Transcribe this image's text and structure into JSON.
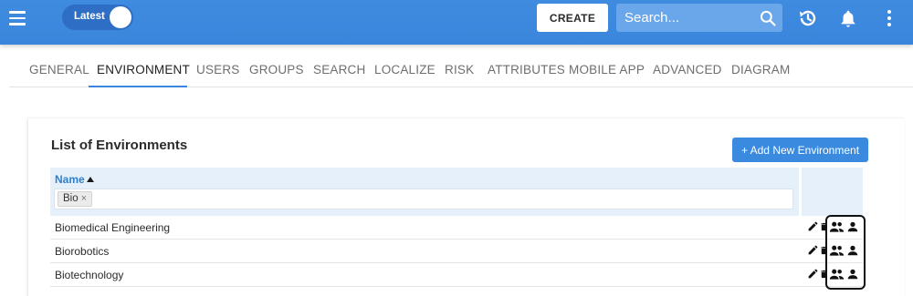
{
  "topbar": {
    "toggle_label": "Latest",
    "create_label": "CREATE",
    "search_placeholder": "Search...",
    "icons": [
      "menu-icon",
      "search-icon",
      "history-icon",
      "bell-icon",
      "more-vert-icon"
    ]
  },
  "tabs": [
    {
      "label": "GENERAL"
    },
    {
      "label": "ENVIRONMENT",
      "active": true
    },
    {
      "label": "USERS"
    },
    {
      "label": "GROUPS"
    },
    {
      "label": "SEARCH"
    },
    {
      "label": "LOCALIZE"
    },
    {
      "label": "RISK"
    },
    {
      "label": "ATTRIBUTES"
    },
    {
      "label": "MOBILE APP"
    },
    {
      "label": "ADVANCED"
    },
    {
      "label": "DIAGRAM"
    }
  ],
  "panel": {
    "title": "List of Environments",
    "add_button": "+ Add New Environment",
    "column_name": "Name",
    "sort": "ascending",
    "filter_chip": "Bio",
    "filter_chip_remove": "×",
    "rows": [
      {
        "name": "Biomedical Engineering"
      },
      {
        "name": "Biorobotics"
      },
      {
        "name": "Biotechnology"
      }
    ],
    "row_actions": [
      "edit-icon",
      "delete-icon",
      "group-icon",
      "person-icon"
    ]
  },
  "colors": {
    "primary": "#3a86dc",
    "header_bg": "#e6f0fb",
    "link": "#2f7fcf"
  }
}
